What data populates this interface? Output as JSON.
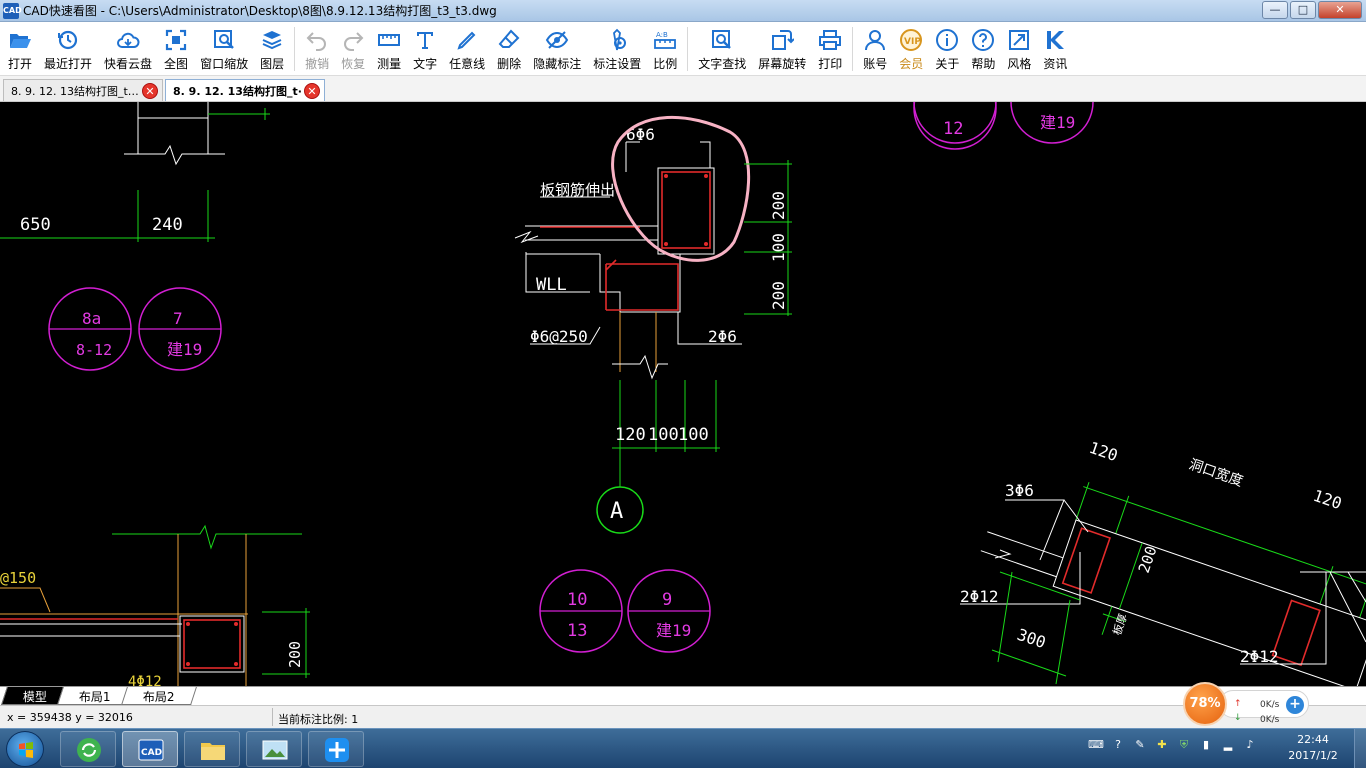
{
  "window": {
    "icon_text": "CAD",
    "title": "CAD快速看图 - C:\\Users\\Administrator\\Desktop\\8图\\8.9.12.13结构打图_t3_t3.dwg",
    "min": "—",
    "max": "□",
    "close": "✕"
  },
  "toolbar": [
    {
      "label": "打开",
      "icon": "folder-open-icon"
    },
    {
      "label": "最近打开",
      "icon": "history-icon"
    },
    {
      "label": "快看云盘",
      "icon": "cloud-icon"
    },
    {
      "label": "全图",
      "icon": "fit-view-icon"
    },
    {
      "label": "窗口缩放",
      "icon": "zoom-window-icon"
    },
    {
      "label": "图层",
      "icon": "layers-icon"
    },
    {
      "label": "撤销",
      "icon": "undo-icon",
      "disabled": true
    },
    {
      "label": "恢复",
      "icon": "redo-icon",
      "disabled": true
    },
    {
      "label": "测量",
      "icon": "measure-icon"
    },
    {
      "label": "文字",
      "icon": "text-icon"
    },
    {
      "label": "任意线",
      "icon": "pen-icon"
    },
    {
      "label": "删除",
      "icon": "eraser-icon"
    },
    {
      "label": "隐藏标注",
      "icon": "eye-hide-icon"
    },
    {
      "label": "标注设置",
      "icon": "settings-icon"
    },
    {
      "label": "比例",
      "icon": "scale-icon"
    },
    {
      "label": "文字查找",
      "icon": "text-search-icon"
    },
    {
      "label": "屏幕旋转",
      "icon": "rotate-icon"
    },
    {
      "label": "打印",
      "icon": "printer-icon"
    },
    {
      "label": "账号",
      "icon": "user-icon"
    },
    {
      "label": "会员",
      "icon": "vip-icon",
      "vip": true
    },
    {
      "label": "关于",
      "icon": "info-icon"
    },
    {
      "label": "帮助",
      "icon": "help-icon"
    },
    {
      "label": "风格",
      "icon": "style-icon"
    },
    {
      "label": "资讯",
      "icon": "news-icon"
    }
  ],
  "tabs": [
    {
      "label": "8. 9. 12. 13结构打图_t…",
      "close": "✕"
    },
    {
      "label": "8. 9. 12. 13结构打图_t·",
      "close": "✕",
      "active": true
    }
  ],
  "drawing": {
    "dims_left": [
      "650",
      "240"
    ],
    "bubble_1": [
      "8a",
      "8-12"
    ],
    "bubble_2": [
      "7",
      "建19"
    ],
    "bubble_top_1": "12",
    "bubble_top_2": "建19",
    "rebar_top": "6Φ6",
    "slab_note": "板钢筋伸出",
    "beam_label": "WLL",
    "stirrup": "Φ6@250",
    "bottom_bar": "2Φ6",
    "vertical_dims": [
      "200",
      "100",
      "200"
    ],
    "horizontal_dims": [
      "120",
      "100",
      "100"
    ],
    "axis_label": "A",
    "bubble_3": [
      "10",
      "13"
    ],
    "bubble_4": [
      "9",
      "建19"
    ],
    "left_rebar": "@150",
    "left_dim": "200",
    "left_bar": "4Φ12",
    "right_dims": [
      "120",
      "洞口宽度",
      "120"
    ],
    "right_rebar_top": "3Φ6",
    "right_dim_mid": "200",
    "right_bar_left": "2Φ12",
    "right_dim_bottom": "300",
    "right_note": "板厚",
    "right_bar_right": "2Φ12"
  },
  "layout_tabs": [
    "模型",
    "布局1",
    "布局2"
  ],
  "status": {
    "coords": "x = 359438  y = 32016",
    "scale": "当前标注比例: 1"
  },
  "net": {
    "percent": "78%",
    "up": "0K/s",
    "down": "0K/s",
    "plus": "+"
  },
  "taskbar": {
    "cad_text": "CAD"
  },
  "clock": {
    "time": "22:44",
    "date": "2017/1/2"
  }
}
